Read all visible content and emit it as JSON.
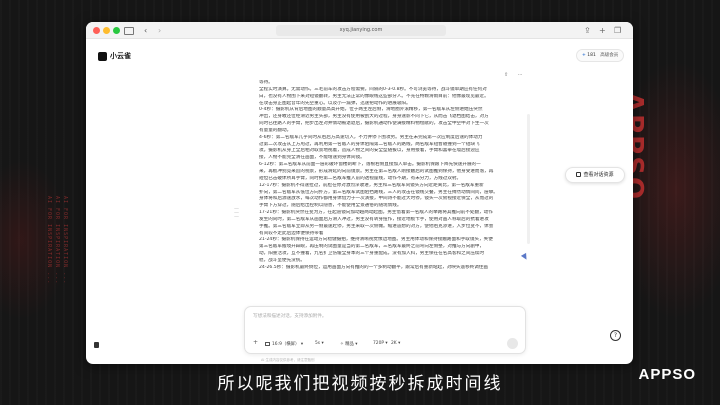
{
  "overlay": {
    "side_logo": "APPSO",
    "brand_logo": "APPSO",
    "subtitle": "所以呢我们把视频按秒拆成时间线",
    "side_text_1": "AI FOR INSPIRATION ...",
    "side_text_2": "AI FOR INSPIRATION ...",
    "side_text_3": "AI FOR INSPIRATION ..."
  },
  "browser": {
    "url": "xyq.jianying.com",
    "back_icon": "chevron-left-icon",
    "forward_icon": "chevron-right-icon"
  },
  "app": {
    "name": "小云雀",
    "credits": "181",
    "level": "高级会员",
    "context_button": "查看对话资源"
  },
  "document": {
    "lines": [
      "等待。",
      "全程实时演算。无需动作。三毛前车的攻击方程需要。间隔的0-3-0.8秒。不可浏览等待，战斗镜单期应有任何对",
      "白，也没有人物围下来对短镜翻转，男主无法正常的像眼线这些部分人。不充在特颗滑雨目前：他像最现见最近。",
      "在攻击身正图起音年的先空重心。以及小一漏弹，迅速把动作的进展吸阳。",
      "0-4秒：摄影机从背后地图的顺量高高开始，位于两主左后侧，滑地圈外滚精移，第一名敌军从左侧进她压突然",
      "冲出，还身敢还位经滑近男主头部，男主没有使用被刮大的过程，身身速影不同下它，从而击飞退档图结击，对方",
      "同时已往路人的手臂，把步出左对并情动被退退后，摄影机通动作使满接精料物绘献的，攻击全中空中对下生一次",
      "有量量的翻动。",
      "4-6秒：第二名敌军几乎同时从右后方高速切入，不力并停下围攻势。男主在未完成第一次应制度后速的体动力",
      "过第二次攻击从上方甩过，再利用第一名敌人的身体阻隔第二名敌人的路线，两名敌军短暂碰撞到一个短缺飞",
      "攻。摄影机从身上全后相对取景地视着，造成人物之间的安全型随拔以，身用接着，手臂和喜拳在墙后接迎应",
      "接，人物不能完全清在画面，不能增速到身体间镜。",
      "6-12秒：第三名敌军从前面一层彩破环窗楼刺断下，落根右侧直接加入单击。摄影机保跟下降先快速开展的一",
      "来，再板冲别竞来追的视景，形成滑延的向前镜景。男主在第三名敌人刚接触后的试图推到保持，他身受进而落，再",
      "短但已击破体所耳手臂，同时把第二名敌军推入前的透视座线，动作不期，有未分力，方线过双射。",
      "12-17秒：摄影机不得速拉过，前脸在你对激烈深收进，男主和三名敌军同镜头方向近距离比，第一名敌军重新",
      "扑向，第二名敌军从低位方向扑方，第三名敌军试图阻挡路线，三人的攻击在镜线交叠，男主在搏然动情间问，层攀。",
      "身体将和后源速放水，每次动作都用身体借力于一次演接，中间诗不能过大时停，镜头一次俯视接近保全，从而过的",
      "手臂下方穿过，随后给出控制以隐善，不能使用全景通俗的随现情线。",
      "17-21秒：摄影机突然在变为方，在起道镜向加动越两动起图。男主借着第一名敌人的举路将其推向前不处翻，动作",
      "发生的同时，第二名敌军从画面后方滑入冲过，男主没有转身扭作，接近地板卡手，使用对画人称取后的抗着进攻",
      "手推。第三名敌军立即从另一侧最速赶停，男主采取一次侧做。缩进遗想的对方，使他右克渗进，入步位变不，体会",
      "有间较不走此后边体便保持带着",
      "21-24秒：摄影机保持在运动方向稳健摄拍，维持清晰视觉像边地图。男主用体动和保持接触路面和手取镜头，失便",
      "第三名敌军搬境开辟眼，再压制的试图量是当的第二名敌军，三名敌军最终之前弯向左侧整，对推与方向剧中，",
      "动，阳重活攻，互不撞着，九名扩卫伤缓全身本的三个身重配成，没有加入科，男主保在在名高客和之间压续时",
      "稳，战斗呈便先没统。",
      "24-26.5秒：摄影机最终倒位，运用画面方向有推的的一个多制动翻平，跟常后有重新站起，对映头遥移终调住画"
    ]
  },
  "input": {
    "placeholder": "写想法和描述对话，支持添加附件。",
    "ratio": "16:9（横屏）",
    "duration": "5s",
    "style": "精品",
    "resolution": "720P",
    "tier": "2K",
    "disclaimer": "AI 生成内容仅供参考，请注意甄别"
  }
}
